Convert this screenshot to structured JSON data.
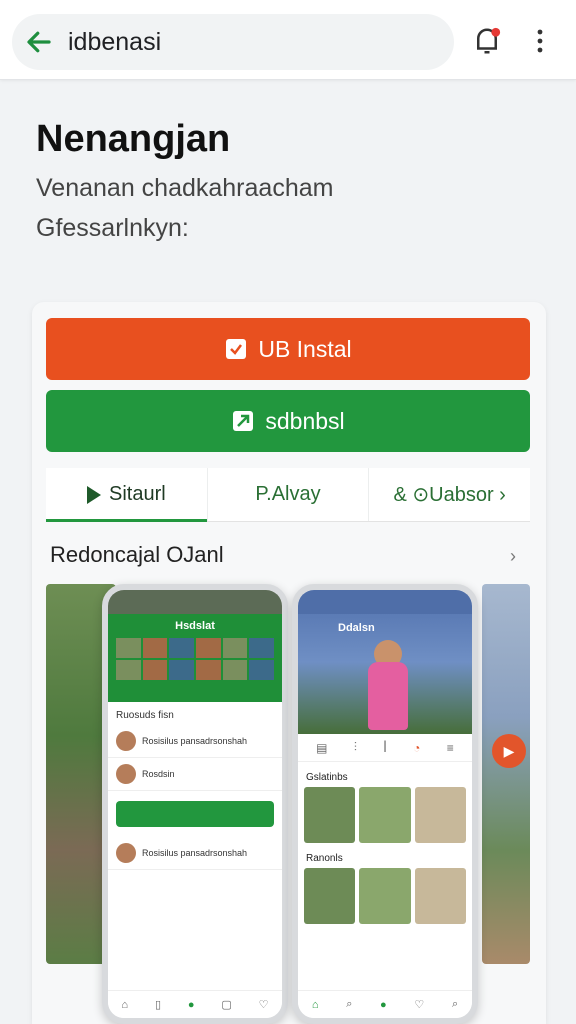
{
  "address_bar": {
    "text": "idbenasi"
  },
  "page": {
    "title": "Nenangjan",
    "subtitle_line1": "Venanan chadkahraacham",
    "subtitle_line2": "Gfessarlnkyn:"
  },
  "card": {
    "primary_button": "UB Instal",
    "secondary_button": "sdbnbsl",
    "tabs": [
      {
        "label": "Sitaurl"
      },
      {
        "label": "P.Alvay"
      },
      {
        "label": "& ⊙Uabsor ›"
      }
    ],
    "section_title": "Redoncajal OJanl",
    "phone1": {
      "header": "Hsdslat",
      "list_title": "Ruosuds fisn",
      "rows": [
        "Rosisilus pansadrsonshah",
        "Rosdsin"
      ]
    },
    "phone2": {
      "header": "Ddalsn",
      "grid_title": "Gslatinbs",
      "second_title": "Ranonls"
    }
  },
  "colors": {
    "orange": "#e8501f",
    "green": "#22973e"
  }
}
